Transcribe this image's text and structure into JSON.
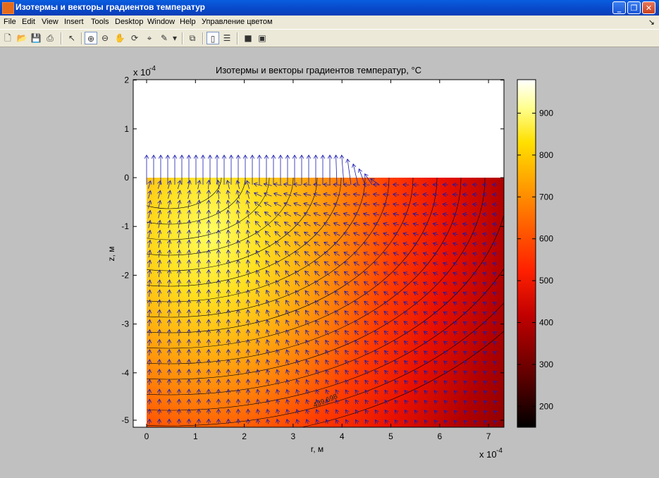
{
  "window": {
    "title": "Изотермы и векторы градиентов температур",
    "minimize_glyph": "_",
    "maximize_glyph": "❐",
    "close_glyph": "✕"
  },
  "menu": [
    "File",
    "Edit",
    "View",
    "Insert",
    "Tools",
    "Desktop",
    "Window",
    "Help",
    "Управление цветом"
  ],
  "toolbar": {
    "icons": [
      "new-figure-icon",
      "open-file-icon",
      "save-icon",
      "print-icon",
      "select-arrow-icon",
      "zoom-in-icon",
      "zoom-out-icon",
      "pan-hand-icon",
      "rotate-3d-icon",
      "data-cursor-icon",
      "brush-icon",
      "link-plot-icon",
      "colorbar-icon",
      "legend-icon",
      "hide-plot-tools-icon",
      "show-plot-tools-icon"
    ]
  },
  "chart_data": {
    "type": "contour",
    "title": "Изотермы и векторы градиентов температур, °C",
    "xlabel": "r, м",
    "ylabel": "z, м",
    "x_exponent_label": "x 10",
    "x_exponent": "-4",
    "y_exponent_label": "x 10",
    "y_exponent": "-4",
    "xlim": [
      -2e-07,
      7.3e-06
    ],
    "ylim": [
      -5.2e-06,
      2e-06
    ],
    "x_ticks": [
      0,
      1,
      2,
      3,
      4,
      5,
      6,
      7
    ],
    "y_ticks": [
      2,
      1,
      0,
      -1,
      -2,
      -3,
      -4,
      -5
    ],
    "grid": false,
    "colormap": "hot",
    "colorbar": {
      "range": [
        150,
        980
      ],
      "ticks": [
        200,
        300,
        400,
        500,
        600,
        700,
        800,
        900
      ],
      "stops": [
        "#000000",
        "#600000",
        "#c00000",
        "#ff2000",
        "#ff6000",
        "#ffa000",
        "#ffe000",
        "#ffff90",
        "#ffffff"
      ]
    },
    "contour_label": "439.698",
    "quiver_color": "#1a1ab0",
    "contour_color": "#000000"
  }
}
